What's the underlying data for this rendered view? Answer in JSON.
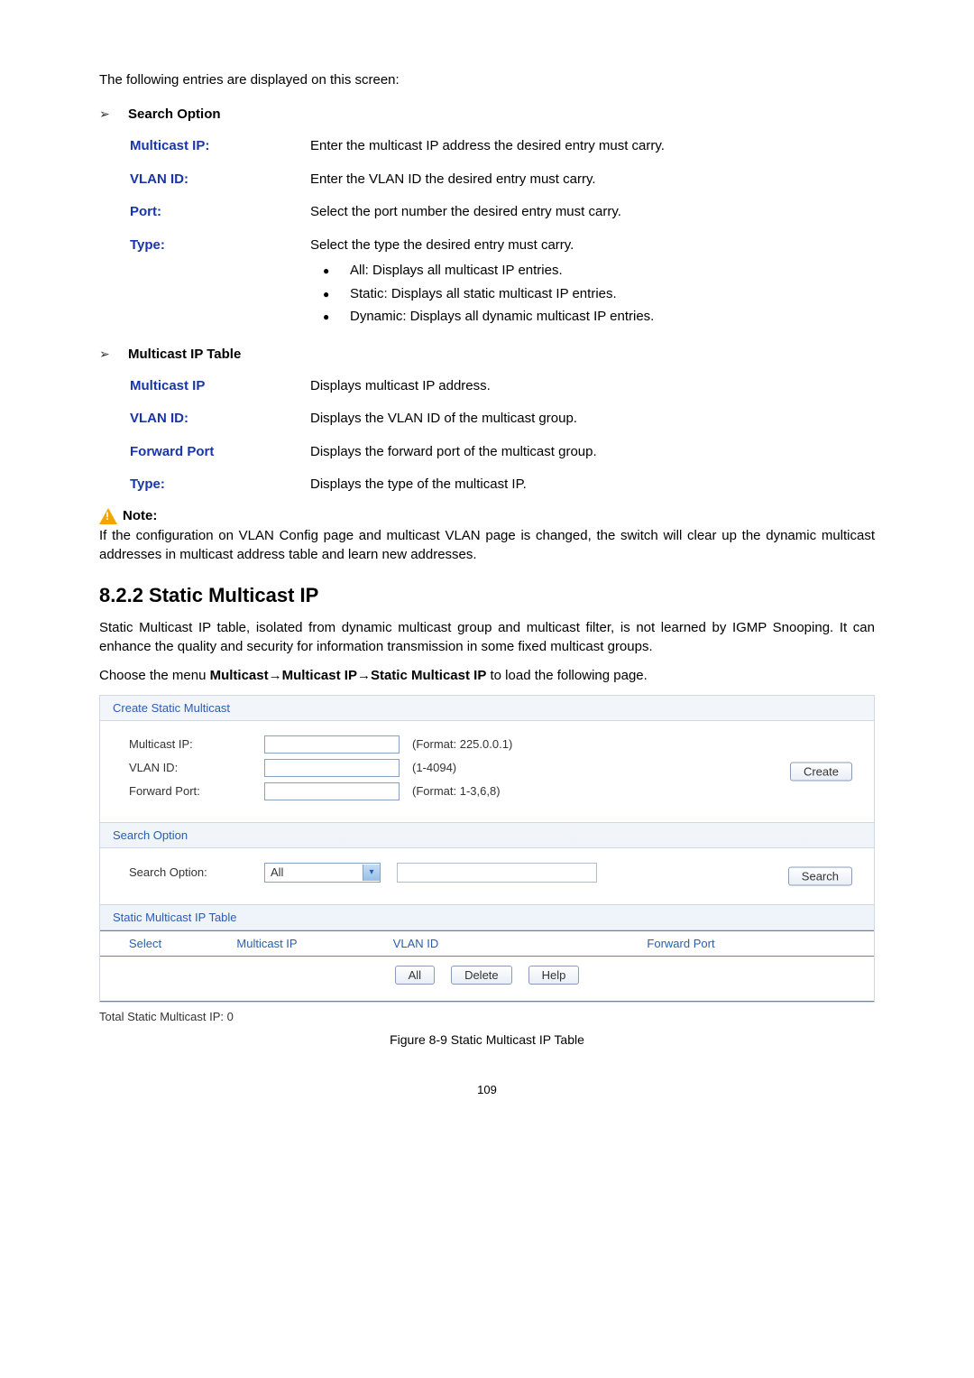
{
  "intro": "The following entries are displayed on this screen:",
  "searchOption": {
    "heading": "Search Option",
    "rows": [
      {
        "term": "Multicast IP:",
        "desc": "Enter the multicast IP address the desired entry must carry."
      },
      {
        "term": "VLAN ID:",
        "desc": "Enter the VLAN ID the desired entry must carry."
      },
      {
        "term": "Port:",
        "desc": "Select the port number the desired entry must carry."
      }
    ],
    "typeRow": {
      "term": "Type:",
      "desc": "Select the type the desired entry must carry.",
      "items": [
        "All: Displays all multicast IP entries.",
        "Static: Displays all static multicast IP entries.",
        "Dynamic: Displays all dynamic multicast IP entries."
      ]
    }
  },
  "multicastTable": {
    "heading": "Multicast IP Table",
    "rows": [
      {
        "term": "Multicast IP",
        "desc": "Displays multicast IP address."
      },
      {
        "term": "VLAN ID:",
        "desc": "Displays the VLAN ID of the multicast group."
      },
      {
        "term": "Forward Port",
        "desc": "Displays the forward port of the multicast group."
      },
      {
        "term": "Type:",
        "desc": "Displays the type of the multicast IP."
      }
    ]
  },
  "note": {
    "label": "Note:",
    "body": "If the configuration on VLAN Config page and multicast VLAN page is changed, the switch will clear up the dynamic multicast addresses in multicast address table and learn new addresses."
  },
  "subsectionTitle": "8.2.2 Static Multicast IP",
  "staticDesc": "Static Multicast IP table, isolated from dynamic multicast group and multicast filter, is not learned by IGMP Snooping. It can enhance the quality and security for information transmission in some fixed multicast groups.",
  "menuPath": {
    "prefix": "Choose the menu ",
    "b1": "Multicast",
    "arrow1": "→",
    "b2": "Multicast IP",
    "arrow2": "→",
    "b3": "Static Multicast IP",
    "suffix": " to load the following page."
  },
  "panel": {
    "createTitle": "Create Static Multicast",
    "multicastIpLabel": "Multicast IP:",
    "multicastIpHint": "(Format: 225.0.0.1)",
    "vlanLabel": "VLAN ID:",
    "vlanHint": "(1-4094)",
    "forwardLabel": "Forward Port:",
    "forwardHint": "(Format: 1-3,6,8)",
    "createBtn": "Create",
    "searchTitle": "Search Option",
    "searchLabel": "Search Option:",
    "searchValue": "All",
    "searchBtn": "Search",
    "tableTitle": "Static Multicast IP Table",
    "cols": {
      "c1": "Select",
      "c2": "Multicast IP",
      "c3": "VLAN ID",
      "c4": "Forward Port"
    },
    "btnAll": "All",
    "btnDelete": "Delete",
    "btnHelp": "Help",
    "total": "Total Static Multicast IP: 0"
  },
  "figureCaption": "Figure 8-9 Static Multicast IP Table",
  "pageNumber": "109"
}
